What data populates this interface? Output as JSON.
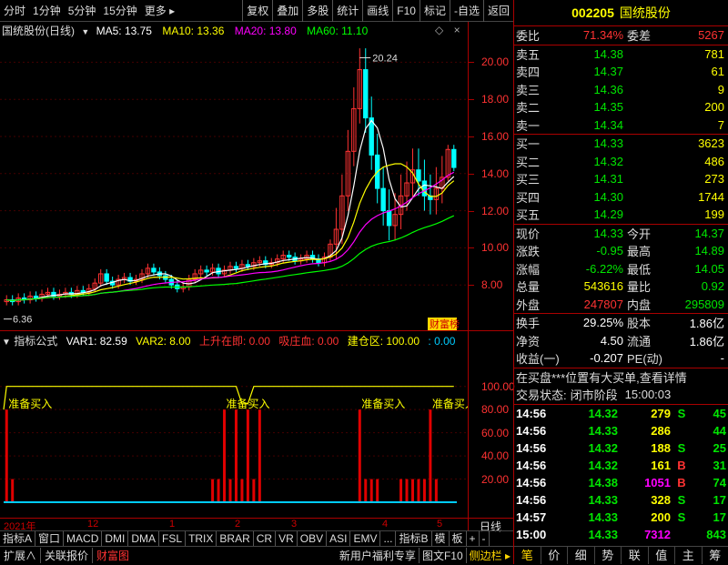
{
  "toolbar": {
    "left": [
      "分时",
      "1分钟",
      "5分钟",
      "15分钟",
      "更多"
    ],
    "right": [
      "复权",
      "叠加",
      "多股",
      "统计",
      "画线",
      "F10",
      "标记",
      "-自选",
      "返回"
    ]
  },
  "title_line": {
    "name": "国统股份(日线)",
    "ma5": "MA5: 13.75",
    "ma10": "MA10: 13.36",
    "ma20": "MA20: 13.80",
    "ma60": "MA60: 11.10",
    "colors": {
      "ma5": "#ffffff",
      "ma10": "#ffff00",
      "ma20": "#ff00ff",
      "ma60": "#00ff00"
    }
  },
  "price_axis": [
    "20.00",
    "18.00",
    "16.00",
    "14.00",
    "12.00",
    "10.00",
    "8.00"
  ],
  "price_annotations": {
    "high": "20.24",
    "low": "6.36"
  },
  "badge": "财富榜",
  "indicator_line": {
    "name": "指标公式",
    "var1": "VAR1: 82.59",
    "var2": "VAR2: 8.00",
    "up": "上升在即: 0.00",
    "attract": "吸庄血: 0.00",
    "build": "建仓区: 100.00",
    "tail": ": 0.00"
  },
  "indicator_axis": [
    "100.00",
    "80.00",
    "60.00",
    "40.00",
    "20.00"
  ],
  "signal_label": "准备买入",
  "date_axis": [
    "2021年",
    "12",
    "1",
    "2",
    "3",
    "4",
    "5"
  ],
  "date_axis_right": "日线",
  "tabs": [
    "指标A",
    "窗口",
    "MACD",
    "DMI",
    "DMA",
    "FSL",
    "TRIX",
    "BRAR",
    "CR",
    "VR",
    "OBV",
    "ASI",
    "EMV",
    "...",
    "指标B",
    "模",
    "板",
    "+",
    "-"
  ],
  "status_bar": {
    "left1": "扩展∧",
    "left2": "关联报价",
    "left3": "财富图",
    "right1": "新用户福利专享",
    "right2": "图文F10",
    "right3": "侧边栏"
  },
  "quote": {
    "code": "002205",
    "name": "国统股份",
    "weibi_label": "委比",
    "weibi": "71.34%",
    "weicha_label": "委差",
    "weicha": "5267",
    "sells": [
      {
        "label": "卖五",
        "price": "14.38",
        "vol": "781"
      },
      {
        "label": "卖四",
        "price": "14.37",
        "vol": "61"
      },
      {
        "label": "卖三",
        "price": "14.36",
        "vol": "9"
      },
      {
        "label": "卖二",
        "price": "14.35",
        "vol": "200"
      },
      {
        "label": "卖一",
        "price": "14.34",
        "vol": "7"
      }
    ],
    "buys": [
      {
        "label": "买一",
        "price": "14.33",
        "vol": "3623"
      },
      {
        "label": "买二",
        "price": "14.32",
        "vol": "486"
      },
      {
        "label": "买三",
        "price": "14.31",
        "vol": "273"
      },
      {
        "label": "买四",
        "price": "14.30",
        "vol": "1744"
      },
      {
        "label": "买五",
        "price": "14.29",
        "vol": "199"
      }
    ],
    "stats": [
      {
        "l1": "现价",
        "v1": "14.33",
        "c1": "green",
        "l2": "今开",
        "v2": "14.37",
        "c2": "green"
      },
      {
        "l1": "涨跌",
        "v1": "-0.95",
        "c1": "green",
        "l2": "最高",
        "v2": "14.89",
        "c2": "green"
      },
      {
        "l1": "涨幅",
        "v1": "-6.22%",
        "c1": "green",
        "l2": "最低",
        "v2": "14.05",
        "c2": "green"
      },
      {
        "l1": "总量",
        "v1": "543616",
        "c1": "yellow",
        "l2": "量比",
        "v2": "0.92",
        "c2": "green"
      },
      {
        "l1": "外盘",
        "v1": "247807",
        "c1": "red",
        "l2": "内盘",
        "v2": "295809",
        "c2": "green"
      }
    ],
    "stats2": [
      {
        "l1": "换手",
        "v1": "29.25%",
        "l2": "股本",
        "v2": "1.86亿"
      },
      {
        "l1": "净资",
        "v1": "4.50",
        "l2": "流通",
        "v2": "1.86亿"
      },
      {
        "l1": "收益(一)",
        "v1": "-0.207",
        "l2": "PE(动)",
        "v2": "-"
      }
    ],
    "notice": "在买盘***位置有大买单,查看详情",
    "trade_status_label": "交易状态:",
    "trade_status": "闭市阶段",
    "trade_time": "15:00:03",
    "ticks": [
      {
        "t": "14:56",
        "p": "14.32",
        "v": "279",
        "s": "S",
        "n": "45",
        "vc": "yellow",
        "sc": "green"
      },
      {
        "t": "14:56",
        "p": "14.33",
        "v": "286",
        "s": "",
        "n": "44",
        "vc": "yellow",
        "sc": "green"
      },
      {
        "t": "14:56",
        "p": "14.32",
        "v": "188",
        "s": "S",
        "n": "25",
        "vc": "yellow",
        "sc": "green"
      },
      {
        "t": "14:56",
        "p": "14.32",
        "v": "161",
        "s": "B",
        "n": "31",
        "vc": "yellow",
        "sc": "red"
      },
      {
        "t": "14:56",
        "p": "14.38",
        "v": "1051",
        "s": "B",
        "n": "74",
        "vc": "mag",
        "sc": "red"
      },
      {
        "t": "14:56",
        "p": "14.33",
        "v": "328",
        "s": "S",
        "n": "17",
        "vc": "yellow",
        "sc": "green"
      },
      {
        "t": "14:57",
        "p": "14.33",
        "v": "200",
        "s": "S",
        "n": "17",
        "vc": "yellow",
        "sc": "green"
      },
      {
        "t": "15:00",
        "p": "14.33",
        "v": "7312",
        "s": "",
        "n": "843",
        "vc": "mag",
        "sc": "green"
      }
    ],
    "bottom_buttons": [
      "笔",
      "价",
      "细",
      "势",
      "联",
      "值",
      "主",
      "筹"
    ]
  },
  "chart_data": {
    "type": "candlestick",
    "stock": "国统股份",
    "period": "日线",
    "ylim": [
      6.0,
      21.0
    ],
    "price_ticks": [
      8,
      10,
      12,
      14,
      16,
      18,
      20
    ],
    "high_label": 20.24,
    "low_label": 6.36,
    "ma": {
      "MA5": 13.75,
      "MA10": 13.36,
      "MA20": 13.8,
      "MA60": 11.1
    },
    "closes": [
      7.2,
      7.1,
      7.3,
      7.2,
      7.4,
      7.3,
      7.5,
      7.6,
      7.4,
      7.5,
      7.6,
      7.5,
      7.7,
      7.6,
      7.8,
      8.1,
      8.6,
      8.2,
      8.0,
      8.3,
      8.4,
      8.2,
      8.3,
      8.6,
      8.9,
      8.7,
      8.5,
      8.3,
      8.0,
      7.8,
      7.9,
      8.3,
      8.6,
      8.8,
      8.7,
      8.9,
      8.6,
      8.8,
      9.0,
      8.9,
      9.1,
      9.0,
      9.2,
      9.3,
      9.1,
      9.2,
      9.4,
      9.6,
      9.5,
      9.3,
      9.4,
      9.6,
      9.4,
      9.2,
      9.5,
      10.2,
      11.0,
      12.8,
      15.2,
      17.5,
      19.6,
      17.0,
      15.0,
      13.2,
      12.0,
      11.2,
      11.8,
      12.8,
      13.5,
      14.2,
      13.6,
      12.8,
      12.6,
      13.2,
      13.8,
      15.3,
      14.33
    ],
    "indicator": {
      "VAR1": 82.59,
      "VAR2": 8.0,
      "上升在即": 0.0,
      "吸庄血": 0.0,
      "建仓区": 100.0,
      "ylim": [
        0,
        110
      ]
    },
    "var1_line": [
      100,
      100,
      100,
      100,
      100,
      100,
      100,
      100,
      100,
      100,
      100,
      100,
      100,
      100,
      100,
      100,
      100,
      100,
      100,
      100,
      100,
      100,
      100,
      100,
      100,
      100,
      100,
      100,
      100,
      100,
      100,
      100,
      100,
      100,
      100,
      100,
      100,
      100,
      100,
      100,
      85,
      85,
      100,
      100,
      100,
      100,
      100,
      100,
      100,
      100,
      100,
      100,
      100,
      100,
      100,
      100,
      100,
      100,
      100,
      100,
      100,
      100,
      100,
      100,
      100,
      100,
      100,
      100,
      100,
      100,
      100,
      100,
      100,
      100,
      100,
      100,
      100
    ],
    "signal_bars": [
      {
        "i": 0,
        "v": 80
      },
      {
        "i": 1,
        "v": 20
      },
      {
        "i": 35,
        "v": 20
      },
      {
        "i": 36,
        "v": 20
      },
      {
        "i": 37,
        "v": 80
      },
      {
        "i": 38,
        "v": 20
      },
      {
        "i": 39,
        "v": 80
      },
      {
        "i": 40,
        "v": 20
      },
      {
        "i": 41,
        "v": 80
      },
      {
        "i": 42,
        "v": 20
      },
      {
        "i": 43,
        "v": 80
      },
      {
        "i": 60,
        "v": 80
      },
      {
        "i": 61,
        "v": 20
      },
      {
        "i": 62,
        "v": 20
      },
      {
        "i": 63,
        "v": 20
      },
      {
        "i": 67,
        "v": 20
      },
      {
        "i": 68,
        "v": 20
      },
      {
        "i": 69,
        "v": 20
      },
      {
        "i": 70,
        "v": 20
      },
      {
        "i": 71,
        "v": 20
      },
      {
        "i": 72,
        "v": 80
      },
      {
        "i": 73,
        "v": 20
      }
    ]
  }
}
